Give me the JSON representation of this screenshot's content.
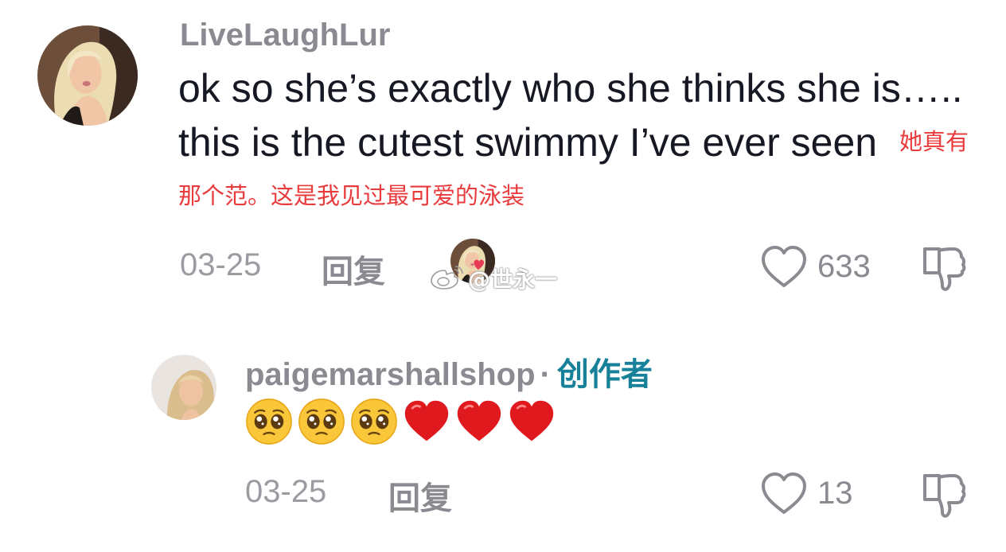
{
  "comment": {
    "username": "LiveLaughLur",
    "text": "ok so she’s exactly who she thinks she is….. this is the cutest swimmy I’ve ever seen",
    "translation": "她真有那个范。这是我见过最可爱的泳装",
    "date": "03-25",
    "reply_label": "回复",
    "likes": "633",
    "avatar_icon": "profile-photo-blonde-woman"
  },
  "watermark": {
    "text": "@世永一",
    "logo_icon": "weibo-logo-icon"
  },
  "reply": {
    "username": "paigemarshallshop",
    "separator": "·",
    "creator_badge": "创作者",
    "emojis": [
      "pleading-face",
      "pleading-face",
      "pleading-face",
      "red-heart",
      "red-heart",
      "red-heart"
    ],
    "date": "03-25",
    "reply_label": "回复",
    "likes": "13",
    "avatar_icon": "profile-photo-blonde-woman"
  },
  "colors": {
    "text": "#161823",
    "muted": "#8a8b91",
    "creator": "#18819a",
    "translation": "#e93a3c"
  }
}
